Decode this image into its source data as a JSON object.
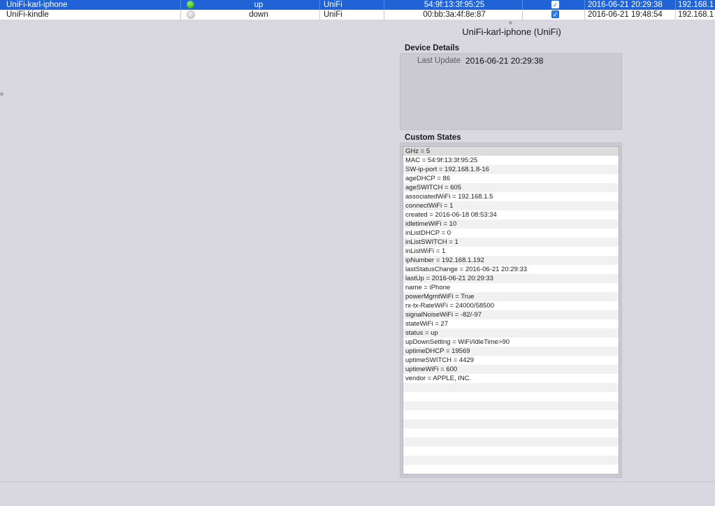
{
  "devices": [
    {
      "name": "UniFi-karl-iphone",
      "status_icon": "green-status-dot",
      "state": "up",
      "type": "UniFi",
      "mac": "54:9f:13:3f:95:25",
      "checked": true,
      "last_update": "2016-06-21 20:29:38",
      "ip": "192.168.1",
      "selected": true
    },
    {
      "name": "UniFi-kindle",
      "status_icon": "grey-status-dot",
      "state": "down",
      "type": "UniFi",
      "mac": "00:bb:3a:4f:8e:87",
      "checked": true,
      "last_update": "2016-06-21 19:48:54",
      "ip": "192.168.1",
      "selected": false
    }
  ],
  "detail_panel": {
    "title": "UniFi-karl-iphone (UniFi)",
    "device_details_heading": "Device Details",
    "last_update_label": "Last Update",
    "last_update_value": "2016-06-21 20:29:38",
    "custom_states_heading": "Custom States"
  },
  "custom_states": [
    "GHz = 5",
    "MAC = 54:9f:13:3f:95:25",
    "SW-ip-port = 192.168.1.8-16",
    "ageDHCP = 86",
    "ageSWITCH = 605",
    "associatedWiFi = 192.168.1.5",
    "connectWiFi = 1",
    "created = 2016-06-18 08:53:34",
    "idletimeWiFi = 10",
    "inListDHCP = 0",
    "inListSWITCH = 1",
    "inListWiFi = 1",
    "ipNumber = 192.168.1.192",
    "lastStatusChange = 2016-06-21 20:29:33",
    "lastUp = 2016-06-21 20:29:33",
    "name = iPhone",
    "powerMgmtWiFi = True",
    "rx-tx-RateWiFi = 24000/58500",
    "signalNoiseWiFi = -82/-97",
    "stateWiFi = 27",
    "status = up",
    "upDownSetting = WiFi/IdleTime>90",
    "uptimeDHCP = 19569",
    "uptimeSWITCH = 4429",
    "uptimeWiFi = 600",
    "vendor = APPLE, INC."
  ],
  "colors": {
    "selection": "#1f63d6",
    "status_up": "#36b51c",
    "status_down": "#cfcfcf",
    "background": "#d9d7e0"
  }
}
